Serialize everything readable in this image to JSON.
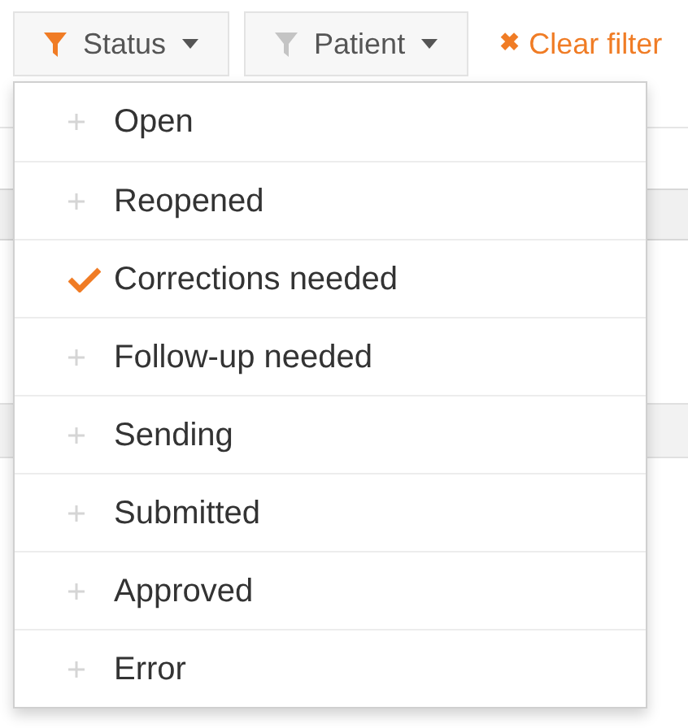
{
  "filters": [
    {
      "label": "Status",
      "active": true
    },
    {
      "label": "Patient",
      "active": false
    }
  ],
  "clear_filter": {
    "icon": "✖",
    "label": "Clear filter"
  },
  "status_menu": {
    "items": [
      {
        "label": "Open",
        "checked": false
      },
      {
        "label": "Reopened",
        "checked": false
      },
      {
        "label": "Corrections needed",
        "checked": true
      },
      {
        "label": "Follow-up needed",
        "checked": false
      },
      {
        "label": "Sending",
        "checked": false
      },
      {
        "label": "Submitted",
        "checked": false
      },
      {
        "label": "Approved",
        "checked": false
      },
      {
        "label": "Error",
        "checked": false
      }
    ]
  }
}
